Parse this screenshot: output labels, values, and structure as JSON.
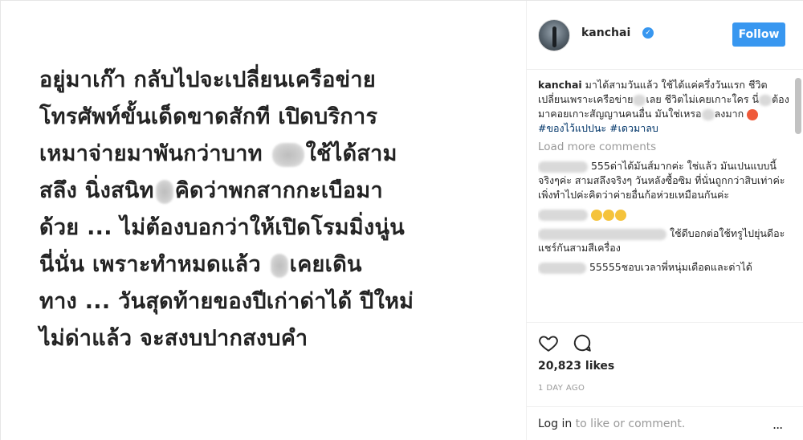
{
  "media": {
    "lines": [
      [
        "อยู่มาเก๊า กลับไปจะเปลี่ยนเครือข่าย"
      ],
      [
        "โทรศัพท์ขั้นเด็ดขาดสักที เปิดบริการ"
      ],
      [
        "เหมาจ่ายมาพันกว่าบาท ",
        "ใช้ได้สาม"
      ],
      [
        "สลึง นิ่งสนิท",
        "คิดว่าพกสากกะเบือมา"
      ],
      [
        "ด้วย ... ไม่ต้องบอกว่าให้เปิดโรมมิ่งนู่น"
      ],
      [
        "นี่นั่น เพราะทำหมดแล้ว ",
        "เคยเดิน"
      ],
      [
        "ทาง ... วันสุดท้ายของปีเก่าด่าได้ ปีใหม่"
      ],
      [
        "ไม่ด่าแล้ว จะสงบปากสงบคำ"
      ]
    ]
  },
  "header": {
    "username": "kanchai",
    "follow_label": "Follow"
  },
  "caption": {
    "username": "kanchai",
    "text_1": "มาได้สามวันแล้ว ใช้ได้แค่ครึ่งวันแรก ชีวิตเปลี่ยนเพราะเครือข่าย",
    "text_2": "เลย ชีวิตไม่เคยเกาะใคร นี่",
    "text_3": "ต้องมาคอยเกาะสัญญานคนอื่น มันใช่เหรอ",
    "text_4": "ลงมาก",
    "hashtag_1": "#ของไว้แปปนะ",
    "hashtag_2": "#เดวมาลบ"
  },
  "load_more": "Load more comments",
  "comments": [
    {
      "text": "555ด่าได้มันส์มากค่ะ ใช่แล้ว มันเปนแบบนี้จริงๆค่ะ สามสลึงจริงๆ วันหลังซื้อซิม ที่นั่นถูกกว่าสิบเท่าค่ะเพิ่งทำไปค่ะคิดว่าค่ายอื่นก้อห่วยเหมือนกันค่ะ"
    },
    {
      "text": ""
    },
    {
      "text": "ใช้ดีบอกต่อใช้ทรูไปยุ่นดีอะแชร์กันสามสีเครื่อง"
    },
    {
      "text": "55555ชอบเวลาพี่หนุ่มเดือดและด่าได้"
    }
  ],
  "likes": "20,823 likes",
  "time": "1 DAY AGO",
  "login": {
    "link": "Log in",
    "text": " to like or comment."
  },
  "more": "..."
}
